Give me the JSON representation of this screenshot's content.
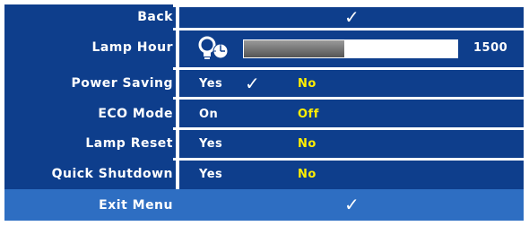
{
  "menu": {
    "back_label": "Back",
    "back_check": "✓",
    "lamp_hour": {
      "label": "Lamp Hour",
      "value": "1500",
      "progress_fraction": 0.47,
      "icon": "lamp-clock-icon"
    },
    "power_saving": {
      "label": "Power Saving",
      "options": [
        "Yes",
        "No"
      ],
      "selected": "No",
      "current_check": "✓"
    },
    "eco_mode": {
      "label": "ECO Mode",
      "options": [
        "On",
        "Off"
      ],
      "selected": "Off"
    },
    "lamp_reset": {
      "label": "Lamp Reset",
      "options": [
        "Yes",
        "No"
      ],
      "selected": "No"
    },
    "quick_shutdown": {
      "label": "Quick Shutdown",
      "options": [
        "Yes",
        "No"
      ],
      "selected": "No"
    },
    "exit_label": "Exit Menu",
    "exit_check": "✓"
  },
  "colors": {
    "panel": "#0e3e8c",
    "exit_bar": "#2e6ec2",
    "selected_option": "#ffee00",
    "text": "#ffffff"
  }
}
